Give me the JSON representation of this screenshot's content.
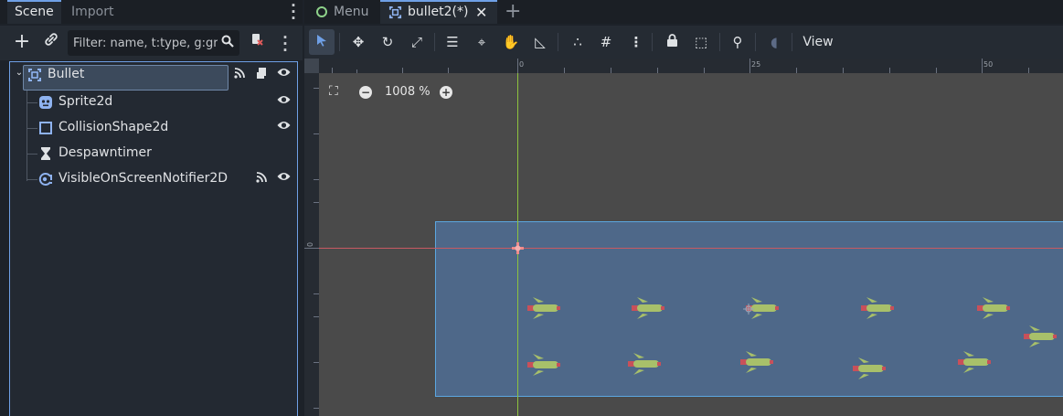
{
  "dock": {
    "tabs": [
      "Scene",
      "Import"
    ],
    "filter_placeholder": "Filter: name, t:type, g:gr",
    "tree": [
      {
        "name": "Bullet",
        "icon": "node2d-icon",
        "selected": true,
        "badges": [
          "signal-icon",
          "script-icon",
          "visibility-icon"
        ]
      },
      {
        "name": "Sprite2d",
        "icon": "sprite2d-icon",
        "badges": [
          "visibility-icon"
        ]
      },
      {
        "name": "CollisionShape2d",
        "icon": "collision-shape-icon",
        "badges": [
          "visibility-icon"
        ]
      },
      {
        "name": "Despawntimer",
        "icon": "timer-icon",
        "badges": []
      },
      {
        "name": "VisibleOnScreenNotifier2D",
        "icon": "notifier-icon",
        "badges": [
          "signal-icon",
          "visibility-icon"
        ]
      }
    ]
  },
  "editor": {
    "tabs": [
      {
        "label": "Menu",
        "active": false
      },
      {
        "label": "bullet2(*)",
        "active": true
      }
    ],
    "toolbar_view_label": "View",
    "zoom_label": "1008 %",
    "ruler_top_labels": [
      "0",
      "25",
      "50"
    ],
    "ruler_left_label": "0"
  },
  "colors": {
    "accent": "#6fa0e6",
    "collision_fill": "#5282be",
    "axis_x": "#c85a62",
    "axis_y": "#8ec23e",
    "bullet_body": "#a8c06a",
    "bullet_tip": "#c8505a"
  }
}
